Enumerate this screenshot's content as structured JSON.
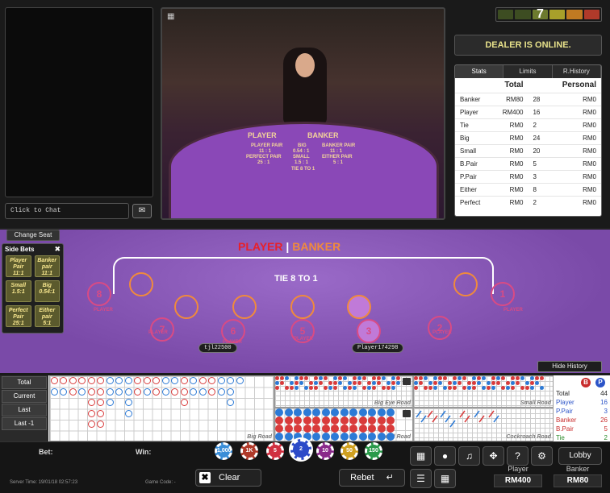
{
  "chat": {
    "placeholder": "Click to Chat"
  },
  "counter": {
    "value": "7"
  },
  "status": {
    "dealer": "DEALER IS ONLINE."
  },
  "stats": {
    "tabs": [
      "Stats",
      "Limits",
      "R.History"
    ],
    "headers": {
      "total": "Total",
      "personal": "Personal"
    },
    "rows": [
      {
        "name": "Banker",
        "amount": "RM80",
        "total": "28",
        "personal": "RM0"
      },
      {
        "name": "Player",
        "amount": "RM400",
        "total": "16",
        "personal": "RM0"
      },
      {
        "name": "Tie",
        "amount": "RM0",
        "total": "2",
        "personal": "RM0"
      },
      {
        "name": "Big",
        "amount": "RM0",
        "total": "24",
        "personal": "RM0"
      },
      {
        "name": "Small",
        "amount": "RM0",
        "total": "20",
        "personal": "RM0"
      },
      {
        "name": "B.Pair",
        "amount": "RM0",
        "total": "5",
        "personal": "RM0"
      },
      {
        "name": "P.Pair",
        "amount": "RM0",
        "total": "3",
        "personal": "RM0"
      },
      {
        "name": "Either",
        "amount": "RM0",
        "total": "8",
        "personal": "RM0"
      },
      {
        "name": "Perfect",
        "amount": "RM0",
        "total": "2",
        "personal": "RM0"
      }
    ]
  },
  "video": {
    "player": "PLAYER",
    "banker": "BANKER",
    "player_pair": "PLAYER PAIR",
    "player_pair_odds": "11 : 1",
    "big": "BIG",
    "big_odds": "0.54 : 1",
    "banker_pair": "BANKER PAIR",
    "banker_pair_odds": "11 : 1",
    "perfect_pair": "PERFECT PAIR",
    "perfect_pair_odds": "25 : 1",
    "small": "SMALL",
    "small_odds": "1.5 : 1",
    "either_pair": "EITHER PAIR",
    "either_pair_odds": "5 : 1",
    "tie": "TIE 8 TO 1"
  },
  "table": {
    "change_seat": "Change Seat",
    "side_bets_title": "Side Bets",
    "side_bets": [
      {
        "name": "Player Pair",
        "odds": "11:1"
      },
      {
        "name": "Banker pair",
        "odds": "11:1"
      },
      {
        "name": "Small",
        "odds": "1.5:1"
      },
      {
        "name": "Big",
        "odds": "0.54:1"
      },
      {
        "name": "Perfect Pair",
        "odds": "25:1"
      },
      {
        "name": "Either pair",
        "odds": "5:1"
      }
    ],
    "title_player": "PLAYER",
    "title_sep": "|",
    "title_banker": "BANKER",
    "tie_text": "TIE 8 TO 1",
    "seat_label": "PLAYER",
    "seats": [
      "8",
      "7",
      "6",
      "5",
      "3",
      "2",
      "1"
    ],
    "player_tags": [
      "tjl22500",
      "Player174298"
    ],
    "hide_history": "Hide History"
  },
  "history": {
    "buttons": [
      "Total",
      "Current",
      "Last",
      "Last -1"
    ],
    "big_eye_road": "Big Eye Road",
    "small_road": "Small Road",
    "bead_road": "Bead Road",
    "cockroach_road": "Cockroach Road",
    "big_road": "Big Road",
    "summary": [
      {
        "label": "Total",
        "value": "44",
        "color": "#222222"
      },
      {
        "label": "Player",
        "value": "16",
        "color": "#2c54c8"
      },
      {
        "label": "P.Pair",
        "value": "3",
        "color": "#2c54c8"
      },
      {
        "label": "Banker",
        "value": "26",
        "color": "#c82c2c"
      },
      {
        "label": "B.Pair",
        "value": "5",
        "color": "#c82c2c"
      },
      {
        "label": "Tie",
        "value": "2",
        "color": "#2a8a2a"
      }
    ],
    "b_badge": "B",
    "p_badge": "P"
  },
  "bottom": {
    "bet_label": "Bet:",
    "win_label": "Win:",
    "chips": [
      "1,000",
      "1K",
      "5",
      "2",
      "10",
      "50",
      "150"
    ],
    "clear": "Clear",
    "rebet": "Rebet",
    "lobby": "Lobby",
    "server_time": "Server Time: 19/01/18 02:57:23",
    "game_code": "Game Code: -",
    "player_label": "Player",
    "player_total": "RM400",
    "banker_label": "Banker",
    "banker_total": "RM80"
  }
}
